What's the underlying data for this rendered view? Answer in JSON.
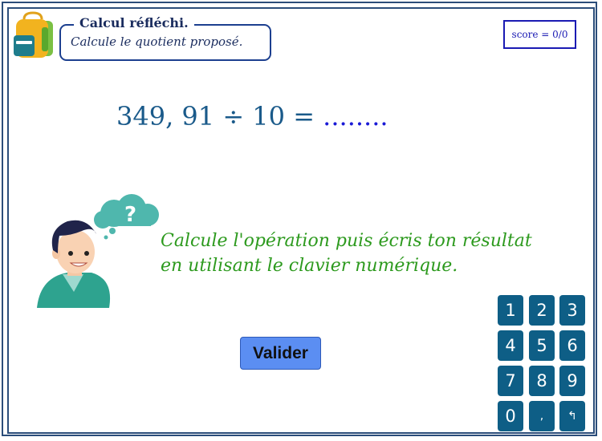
{
  "header": {
    "title": "Calcul réfléchi.",
    "subtitle": "Calcule le quotient proposé."
  },
  "score": {
    "text": "score = 0/0"
  },
  "exercise": {
    "expression": "349, 91 ÷ 10 =",
    "answer_placeholder": "........"
  },
  "illustration": {
    "bubble_symbol": "?"
  },
  "instruction": {
    "line1": "Calcule l'opération puis écris ton résultat",
    "line2": "en utilisant le clavier numérique."
  },
  "buttons": {
    "validate_label": "Valider"
  },
  "keypad": {
    "keys": [
      "1",
      "2",
      "3",
      "4",
      "5",
      "6",
      "7",
      "8",
      "9",
      "0",
      ",",
      "↰"
    ]
  },
  "colors": {
    "frame": "#2b4d7a",
    "header_text": "#1a2c5e",
    "score_border": "#1a1ab3",
    "expression": "#1a5a8a",
    "instruction": "#2d9a1e",
    "validate_button": "#5b8ef2",
    "keypad_key": "#0e5e86"
  }
}
